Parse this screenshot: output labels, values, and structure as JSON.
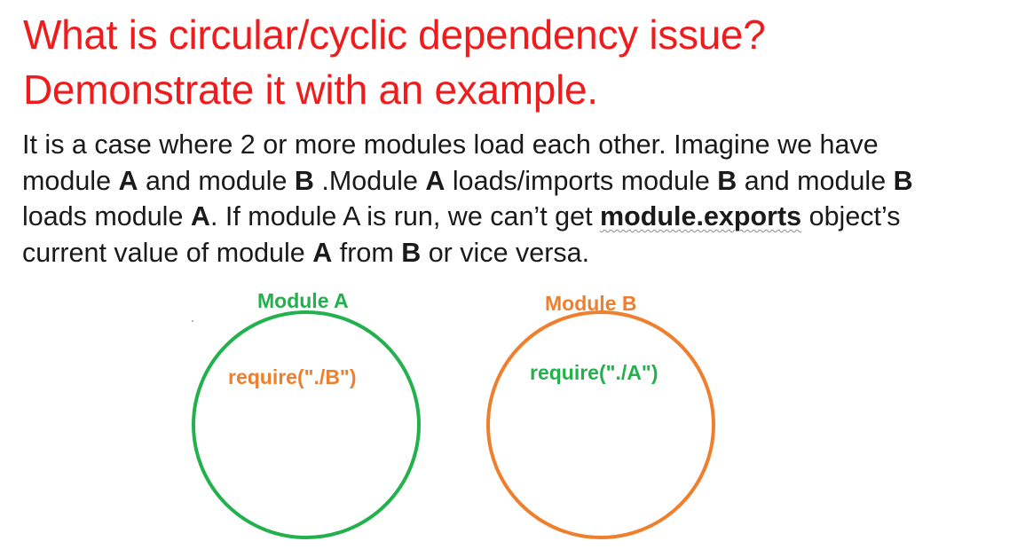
{
  "title": {
    "line1": "What is circular/cyclic dependency issue?",
    "line2": "Demonstrate it with an example."
  },
  "body": {
    "l1": "It is a case where 2 or more modules load each other. Imagine we have",
    "l2_a": "module ",
    "l2_b": "A",
    "l2_c": " and module ",
    "l2_d": "B",
    "l2_e": " .Module ",
    "l2_f": "A",
    "l2_g": " loads/imports module ",
    "l2_h": "B",
    "l2_i": " and module ",
    "l2_j": "B",
    "l3_a": "loads module ",
    "l3_b": "A",
    "l3_c": ". If module A is run, we can’t get ",
    "l3_d": "module.exports",
    "l3_e": " object’s",
    "l4_a": "current value of module ",
    "l4_b": "A",
    "l4_c": " from ",
    "l4_d": "B",
    "l4_e": " or vice versa."
  },
  "diagram": {
    "module_a": {
      "label": "Module A",
      "code": "require(\"./B\")",
      "label_color": "#22b14c",
      "code_color": "#f07f2d",
      "circle_color": "#22b14c"
    },
    "module_b": {
      "label": "Module B",
      "code": "require(\"./A\")",
      "label_color": "#f07f2d",
      "code_color": "#22b14c",
      "circle_color": "#f07f2d"
    }
  },
  "colors": {
    "title": "#ee1c1c",
    "body": "#1a1a1a"
  }
}
